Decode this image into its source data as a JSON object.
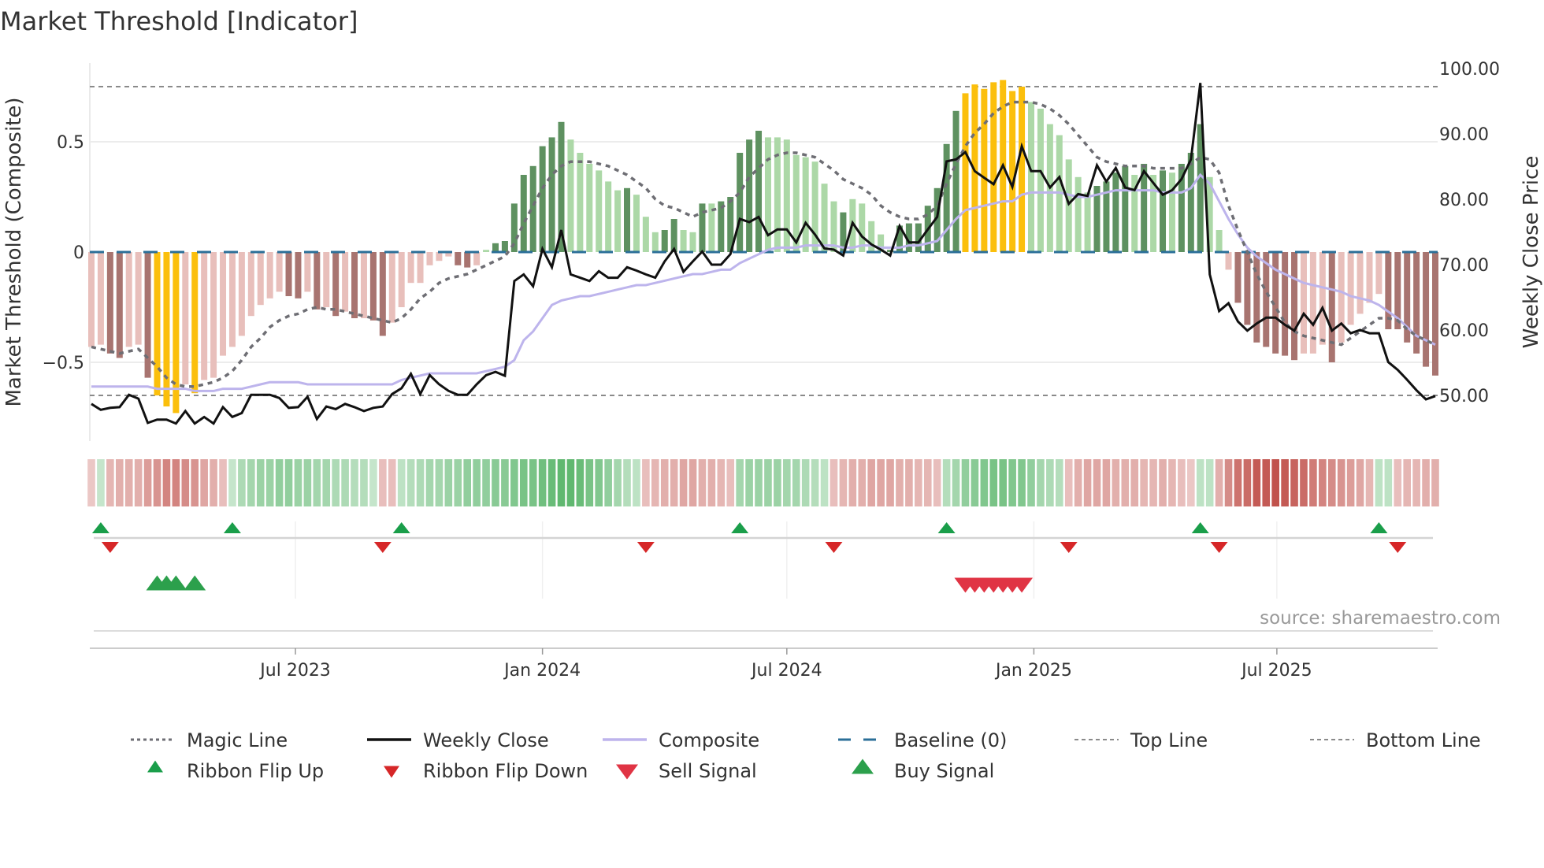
{
  "title": "Market Threshold [Indicator]",
  "source": "source: sharemaestro.com",
  "chart_data": {
    "type": "bar",
    "title": "Market Threshold [Indicator]",
    "xlabel": "",
    "ylabel_left": "Market Threshold (Composite)",
    "ylabel_right": "Weekly Close Price",
    "start_date": "2023-01-30",
    "frequency": "weekly",
    "ylim_left": [
      -0.8,
      0.82
    ],
    "ylim_right": [
      45,
      100
    ],
    "left_ticks": [
      {
        "value": 0.5,
        "label": "0.5"
      },
      {
        "value": 0,
        "label": "0"
      },
      {
        "value": -0.5,
        "label": "−0.5"
      }
    ],
    "right_ticks": [
      {
        "value": 100,
        "label": "100.00"
      },
      {
        "value": 90,
        "label": "90.00"
      },
      {
        "value": 80,
        "label": "80.00"
      },
      {
        "value": 70,
        "label": "70.00"
      },
      {
        "value": 60,
        "label": "60.00"
      },
      {
        "value": 50,
        "label": "50.00"
      }
    ],
    "x_ticks": [
      {
        "date": "2023-07-01",
        "label": "Jul 2023"
      },
      {
        "date": "2024-01-01",
        "label": "Jan 2024"
      },
      {
        "date": "2024-07-01",
        "label": "Jul 2024"
      },
      {
        "date": "2025-01-01",
        "label": "Jan 2025"
      },
      {
        "date": "2025-07-01",
        "label": "Jul 2025"
      }
    ],
    "top_line": 0.75,
    "bottom_line": -0.65,
    "baseline": 0,
    "grid": true,
    "composite_bars": [
      -0.43,
      -0.42,
      -0.46,
      -0.48,
      -0.43,
      -0.42,
      -0.57,
      -0.65,
      -0.7,
      -0.73,
      -0.6,
      -0.64,
      -0.58,
      -0.57,
      -0.47,
      -0.43,
      -0.38,
      -0.29,
      -0.24,
      -0.21,
      -0.18,
      -0.2,
      -0.21,
      -0.18,
      -0.26,
      -0.25,
      -0.29,
      -0.27,
      -0.3,
      -0.3,
      -0.31,
      -0.38,
      -0.32,
      -0.25,
      -0.14,
      -0.14,
      -0.06,
      -0.04,
      -0.02,
      -0.06,
      -0.07,
      -0.06,
      0.01,
      0.04,
      0.05,
      0.22,
      0.35,
      0.39,
      0.48,
      0.52,
      0.59,
      0.51,
      0.45,
      0.4,
      0.37,
      0.32,
      0.28,
      0.29,
      0.26,
      0.16,
      0.09,
      0.1,
      0.15,
      0.1,
      0.09,
      0.22,
      0.22,
      0.23,
      0.25,
      0.45,
      0.51,
      0.55,
      0.52,
      0.52,
      0.51,
      0.44,
      0.43,
      0.41,
      0.31,
      0.23,
      0.18,
      0.24,
      0.22,
      0.14,
      0.08,
      0.01,
      0.12,
      0.13,
      0.13,
      0.21,
      0.29,
      0.49,
      0.64,
      0.72,
      0.76,
      0.74,
      0.77,
      0.78,
      0.73,
      0.75,
      0.68,
      0.65,
      0.58,
      0.53,
      0.42,
      0.34,
      0.27,
      0.3,
      0.32,
      0.36,
      0.39,
      0.35,
      0.4,
      0.35,
      0.37,
      0.36,
      0.4,
      0.45,
      0.58,
      0.34,
      0.1,
      -0.08,
      -0.23,
      -0.33,
      -0.41,
      -0.43,
      -0.46,
      -0.47,
      -0.49,
      -0.46,
      -0.46,
      -0.42,
      -0.5,
      -0.41,
      -0.33,
      -0.28,
      -0.23,
      -0.19,
      -0.35,
      -0.35,
      -0.41,
      -0.46,
      -0.52,
      -0.56
    ],
    "bar_states": "LLDDLLDGGGLGLLLLLLLLLDDLDLDLDLDDLLLLLLLDDLgddddddddggggggdgggddggdgdddddggggggggdggggddddddddGGGGGGGgggggggddddgdgdgdddggLDDDDDDDLLLDLLLLLDDDDDD",
    "bar_state_legend": {
      "L": "weak negative",
      "D": "strong negative",
      "G": "extreme",
      "g": "weak positive",
      "d": "strong positive"
    },
    "magic_line": [
      -0.43,
      -0.44,
      -0.45,
      -0.46,
      -0.45,
      -0.44,
      -0.48,
      -0.52,
      -0.57,
      -0.6,
      -0.61,
      -0.61,
      -0.6,
      -0.59,
      -0.57,
      -0.54,
      -0.49,
      -0.43,
      -0.39,
      -0.34,
      -0.31,
      -0.29,
      -0.28,
      -0.26,
      -0.25,
      -0.26,
      -0.26,
      -0.27,
      -0.28,
      -0.29,
      -0.3,
      -0.31,
      -0.32,
      -0.3,
      -0.26,
      -0.21,
      -0.18,
      -0.14,
      -0.12,
      -0.11,
      -0.1,
      -0.08,
      -0.06,
      -0.04,
      -0.02,
      0.04,
      0.13,
      0.21,
      0.29,
      0.35,
      0.39,
      0.41,
      0.41,
      0.41,
      0.4,
      0.39,
      0.37,
      0.35,
      0.32,
      0.29,
      0.24,
      0.21,
      0.2,
      0.18,
      0.16,
      0.18,
      0.19,
      0.2,
      0.23,
      0.27,
      0.34,
      0.38,
      0.42,
      0.44,
      0.45,
      0.45,
      0.44,
      0.43,
      0.4,
      0.37,
      0.33,
      0.31,
      0.29,
      0.26,
      0.21,
      0.18,
      0.16,
      0.15,
      0.15,
      0.17,
      0.21,
      0.31,
      0.4,
      0.48,
      0.54,
      0.58,
      0.63,
      0.66,
      0.68,
      0.68,
      0.68,
      0.67,
      0.65,
      0.62,
      0.58,
      0.53,
      0.48,
      0.43,
      0.41,
      0.4,
      0.39,
      0.39,
      0.39,
      0.38,
      0.38,
      0.38,
      0.38,
      0.4,
      0.43,
      0.42,
      0.36,
      0.21,
      0.1,
      0.0,
      -0.1,
      -0.18,
      -0.25,
      -0.32,
      -0.36,
      -0.38,
      -0.39,
      -0.4,
      -0.41,
      -0.42,
      -0.39,
      -0.36,
      -0.33,
      -0.3,
      -0.3,
      -0.31,
      -0.35,
      -0.38,
      -0.4,
      -0.42
    ],
    "composite_line": [
      -0.61,
      -0.61,
      -0.61,
      -0.61,
      -0.61,
      -0.61,
      -0.61,
      -0.62,
      -0.62,
      -0.62,
      -0.62,
      -0.63,
      -0.63,
      -0.63,
      -0.62,
      -0.62,
      -0.62,
      -0.61,
      -0.6,
      -0.59,
      -0.59,
      -0.59,
      -0.59,
      -0.6,
      -0.6,
      -0.6,
      -0.6,
      -0.6,
      -0.6,
      -0.6,
      -0.6,
      -0.6,
      -0.6,
      -0.58,
      -0.57,
      -0.56,
      -0.55,
      -0.55,
      -0.55,
      -0.55,
      -0.55,
      -0.55,
      -0.54,
      -0.53,
      -0.52,
      -0.49,
      -0.4,
      -0.36,
      -0.3,
      -0.24,
      -0.22,
      -0.21,
      -0.2,
      -0.2,
      -0.19,
      -0.18,
      -0.17,
      -0.16,
      -0.15,
      -0.15,
      -0.14,
      -0.13,
      -0.12,
      -0.11,
      -0.1,
      -0.1,
      -0.09,
      -0.08,
      -0.08,
      -0.05,
      -0.03,
      -0.01,
      0.01,
      0.02,
      0.02,
      0.02,
      0.03,
      0.03,
      0.03,
      0.03,
      0.02,
      0.02,
      0.03,
      0.03,
      0.02,
      0.02,
      0.02,
      0.03,
      0.03,
      0.04,
      0.05,
      0.1,
      0.15,
      0.19,
      0.2,
      0.21,
      0.22,
      0.23,
      0.23,
      0.26,
      0.27,
      0.27,
      0.27,
      0.27,
      0.26,
      0.25,
      0.25,
      0.26,
      0.27,
      0.28,
      0.28,
      0.28,
      0.28,
      0.28,
      0.27,
      0.27,
      0.27,
      0.29,
      0.35,
      0.31,
      0.23,
      0.15,
      0.08,
      0.02,
      -0.02,
      -0.05,
      -0.08,
      -0.1,
      -0.12,
      -0.14,
      -0.15,
      -0.16,
      -0.17,
      -0.18,
      -0.2,
      -0.21,
      -0.22,
      -0.24,
      -0.27,
      -0.3,
      -0.34,
      -0.38,
      -0.4,
      -0.42
    ],
    "weekly_close": [
      48.7,
      47.8,
      48.1,
      48.2,
      50.1,
      49.5,
      45.8,
      46.3,
      46.3,
      45.7,
      47.6,
      45.7,
      46.7,
      45.7,
      48.2,
      46.7,
      47.3,
      50.1,
      50.1,
      50.1,
      49.6,
      48.1,
      48.2,
      49.8,
      46.4,
      48.3,
      47.9,
      48.7,
      48.2,
      47.6,
      48.1,
      48.3,
      50.2,
      51.1,
      53.3,
      50.2,
      53.1,
      51.7,
      50.7,
      50.1,
      50.1,
      51.7,
      53.1,
      53.6,
      53.0,
      67.5,
      68.5,
      66.7,
      72.4,
      69.6,
      75.3,
      68.5,
      68.0,
      67.5,
      69.0,
      68.0,
      68.0,
      69.6,
      69.1,
      68.5,
      68.0,
      70.5,
      72.4,
      68.9,
      70.5,
      72.0,
      70.0,
      70.0,
      71.6,
      77.0,
      76.5,
      77.3,
      74.5,
      75.4,
      75.4,
      73.4,
      76.4,
      74.6,
      72.5,
      72.3,
      71.4,
      76.4,
      74.3,
      73.1,
      72.3,
      71.4,
      75.9,
      73.4,
      73.4,
      75.4,
      77.3,
      85.8,
      86.1,
      87.2,
      84.3,
      83.3,
      82.3,
      85.2,
      81.9,
      88.1,
      84.3,
      84.3,
      81.8,
      83.4,
      79.3,
      80.8,
      80.5,
      85.2,
      82.7,
      84.8,
      81.8,
      81.4,
      84.3,
      82.5,
      80.7,
      81.4,
      83.1,
      86.1,
      97.8,
      68.5,
      62.9,
      64.1,
      61.3,
      59.9,
      61.0,
      61.9,
      61.9,
      60.8,
      59.9,
      62.5,
      60.8,
      63.4,
      59.9,
      61.0,
      59.5,
      60.0,
      59.5,
      59.5,
      55.1,
      53.9,
      52.4,
      50.8,
      49.4,
      49.9
    ],
    "ribbon": [
      -0.15,
      0.15,
      -0.25,
      -0.3,
      -0.3,
      -0.3,
      -0.4,
      -0.45,
      -0.55,
      -0.55,
      -0.5,
      -0.45,
      -0.35,
      -0.3,
      -0.2,
      0.15,
      0.3,
      0.35,
      0.4,
      0.4,
      0.45,
      0.45,
      0.4,
      0.4,
      0.35,
      0.35,
      0.3,
      0.3,
      0.25,
      0.25,
      0.15,
      -0.2,
      -0.2,
      0.2,
      0.25,
      0.3,
      0.35,
      0.35,
      0.4,
      0.4,
      0.45,
      0.45,
      0.45,
      0.5,
      0.5,
      0.55,
      0.6,
      0.6,
      0.65,
      0.7,
      0.75,
      0.75,
      0.7,
      0.6,
      0.55,
      0.45,
      0.35,
      0.25,
      0.2,
      -0.2,
      -0.25,
      -0.3,
      -0.3,
      -0.35,
      -0.35,
      -0.3,
      -0.3,
      -0.25,
      -0.2,
      0.35,
      0.4,
      0.4,
      0.4,
      0.4,
      0.35,
      0.35,
      0.3,
      0.25,
      0.2,
      -0.2,
      -0.25,
      -0.3,
      -0.3,
      -0.35,
      -0.35,
      -0.35,
      -0.3,
      -0.3,
      -0.25,
      -0.25,
      -0.2,
      0.25,
      0.35,
      0.45,
      0.5,
      0.55,
      0.6,
      0.6,
      0.55,
      0.55,
      0.45,
      0.35,
      0.3,
      0.25,
      -0.2,
      -0.3,
      -0.35,
      -0.35,
      -0.35,
      -0.3,
      -0.3,
      -0.3,
      -0.25,
      -0.25,
      -0.3,
      -0.25,
      -0.2,
      -0.15,
      0.2,
      0.2,
      -0.3,
      -0.5,
      -0.65,
      -0.7,
      -0.8,
      -0.8,
      -0.85,
      -0.8,
      -0.75,
      -0.7,
      -0.6,
      -0.55,
      -0.5,
      -0.45,
      -0.4,
      -0.35,
      -0.25,
      0.2,
      0.2,
      -0.2,
      -0.25,
      -0.25,
      -0.3,
      -0.3
    ],
    "signals": {
      "ribbon_flip_up": [
        2,
        16,
        34,
        70,
        92,
        119,
        138
      ],
      "ribbon_flip_down": [
        3,
        32,
        60,
        80,
        105,
        121,
        140
      ],
      "buy": [
        8,
        9,
        10,
        12
      ],
      "sell": [
        94,
        95,
        96,
        97,
        98,
        99,
        100
      ]
    },
    "legend": [
      {
        "label": "Magic Line",
        "key": "dotted-gray"
      },
      {
        "label": "Weekly Close",
        "key": "solid-black"
      },
      {
        "label": "Composite",
        "key": "solid-lavender"
      },
      {
        "label": "Baseline (0)",
        "key": "dashed-blue"
      },
      {
        "label": "Top Line",
        "key": "dashed-gray"
      },
      {
        "label": "Bottom Line",
        "key": "dashed-gray"
      },
      {
        "label": "Ribbon Flip Up",
        "key": "triangle-up-green"
      },
      {
        "label": "Ribbon Flip Down",
        "key": "triangle-down-red"
      },
      {
        "label": "Sell Signal",
        "key": "triangle-down-crimson"
      },
      {
        "label": "Buy Signal",
        "key": "triangle-up-green-large"
      }
    ],
    "legend_placement": "bottom"
  },
  "colors": {
    "L": "#e8bfbb",
    "D": "#a87470",
    "G": "#fbbf0c",
    "g": "#acd8a7",
    "d": "#5e9160",
    "magic": "#6e6e74",
    "close": "#111111",
    "composite": "#bdb4ec",
    "baseline": "#2b6f98",
    "refline": "#8a8a8a",
    "grid": "#ececec",
    "ribbon_pos": "#4caf5e",
    "ribbon_neg": "#c0504a",
    "flip_up": "#1a9e4a",
    "flip_down": "#d62728",
    "buy": "#2ca04c",
    "sell": "#e03444"
  }
}
